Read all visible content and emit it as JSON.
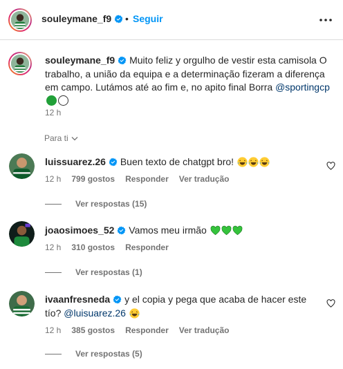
{
  "header": {
    "username": "souleymane_f9",
    "separator": "•",
    "follow_label": "Seguir"
  },
  "caption": {
    "username": "souleymane_f9",
    "text": "Muito feliz y orgulho de vestir esta camisola O trabalho, a união da equipa e a determinação fizeram a diferença em campo. Lutámos até ao fim e, no apito final Borra",
    "mention": "@sportingcp",
    "time": "12 h"
  },
  "sort": {
    "label": "Para ti"
  },
  "comments": [
    {
      "username": "luissuarez.26",
      "text": "Buen texto de chatgpt bro!",
      "emojis": [
        "laughing-emoji",
        "laughing-emoji",
        "laughing-emoji"
      ],
      "time": "12 h",
      "likes": "799 gostos",
      "reply_label": "Responder",
      "translate_label": "Ver tradução",
      "replies_label": "Ver respostas (15)"
    },
    {
      "username": "joaosimoes_52",
      "text": "Vamos meu irmão",
      "emojis": [
        "green-heart-emoji",
        "green-heart-emoji",
        "green-heart-emoji"
      ],
      "time": "12 h",
      "likes": "310 gostos",
      "reply_label": "Responder",
      "replies_label": "Ver respostas (1)"
    },
    {
      "username": "ivaanfresneda",
      "text_line1": "y el copia y pega que acaba de hacer este",
      "text_line2": "tío?",
      "mention": "@luisuarez.26",
      "emojis": [
        "laughing-emoji"
      ],
      "time": "12 h",
      "likes": "385 gostos",
      "reply_label": "Responder",
      "translate_label": "Ver tradução",
      "replies_label": "Ver respostas (5)"
    }
  ],
  "colors": {
    "accent": "#0095f6",
    "verified": "#0095f6",
    "mention": "#00376b",
    "secondary_text": "#737373",
    "sporting_green": "#21a038"
  }
}
